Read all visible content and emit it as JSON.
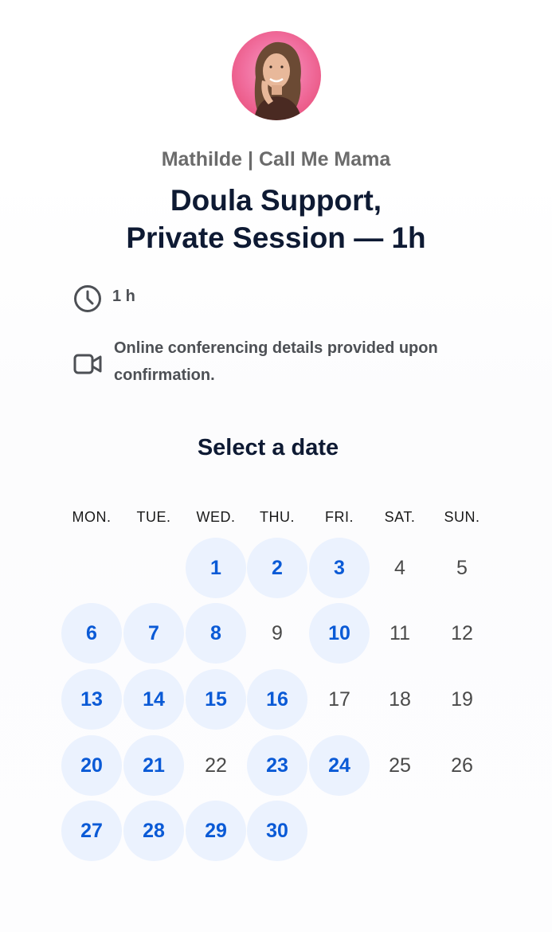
{
  "owner_name": "Mathilde | Call Me Mama",
  "event": {
    "title_line1": "Doula Support,",
    "title_line2": "Private Session — 1h",
    "duration": "1 h",
    "location_line1": "Online conferencing details provided upon",
    "location_line2": "confirmation.",
    "duration_icon": "clock-icon",
    "location_icon": "video-camera-icon"
  },
  "calendar": {
    "heading": "Select a date",
    "weekdays": [
      "MON.",
      "TUE.",
      "WED.",
      "THU.",
      "FRI.",
      "SAT.",
      "SUN."
    ],
    "first_weekday_index": 2,
    "days": [
      {
        "label": "1",
        "available": true
      },
      {
        "label": "2",
        "available": true
      },
      {
        "label": "3",
        "available": true
      },
      {
        "label": "4",
        "available": false
      },
      {
        "label": "5",
        "available": false
      },
      {
        "label": "6",
        "available": true
      },
      {
        "label": "7",
        "available": true
      },
      {
        "label": "8",
        "available": true
      },
      {
        "label": "9",
        "available": false
      },
      {
        "label": "10",
        "available": true
      },
      {
        "label": "11",
        "available": false
      },
      {
        "label": "12",
        "available": false
      },
      {
        "label": "13",
        "available": true
      },
      {
        "label": "14",
        "available": true
      },
      {
        "label": "15",
        "available": true
      },
      {
        "label": "16",
        "available": true
      },
      {
        "label": "17",
        "available": false
      },
      {
        "label": "18",
        "available": false
      },
      {
        "label": "19",
        "available": false
      },
      {
        "label": "20",
        "available": true
      },
      {
        "label": "21",
        "available": true
      },
      {
        "label": "22",
        "available": false
      },
      {
        "label": "23",
        "available": true
      },
      {
        "label": "24",
        "available": true
      },
      {
        "label": "25",
        "available": false
      },
      {
        "label": "26",
        "available": false
      },
      {
        "label": "27",
        "available": true
      },
      {
        "label": "28",
        "available": true
      },
      {
        "label": "29",
        "available": true
      },
      {
        "label": "30",
        "available": true
      }
    ]
  },
  "colors": {
    "available_bg": "#ebf2fe",
    "available_text": "#0a5ad6",
    "title_text": "#0e1a33",
    "avatar_ring": "#f47fae"
  }
}
